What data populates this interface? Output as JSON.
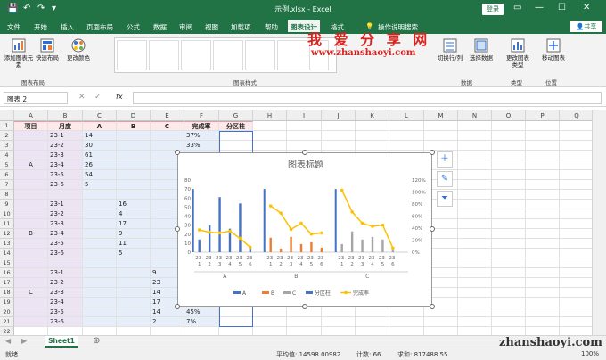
{
  "window": {
    "title": "示例.xlsx  -  Excel",
    "login_label": "登录",
    "quick_access": [
      "💾",
      "↶",
      "↷",
      "▾"
    ],
    "buttons": [
      "—",
      "☐",
      "✕",
      "▭"
    ]
  },
  "tabs": [
    "文件",
    "开始",
    "插入",
    "页面布局",
    "公式",
    "数据",
    "审阅",
    "视图",
    "加载项",
    "帮助",
    "图表设计",
    "格式"
  ],
  "active_tab": "图表设计",
  "tell_me": "操作说明搜索",
  "share_label": "共享",
  "ribbon": {
    "add_element": "添加图表元素",
    "quick_layout": "快速布局",
    "change_color": "更改颜色",
    "group_layout": "图表布局",
    "group_styles": "图表样式",
    "switch_rowcol": "切换行/列",
    "select_data": "选择数据",
    "group_data": "数据",
    "change_type": "更改图表类型",
    "group_type": "类型",
    "move_chart": "移动图表",
    "group_location": "位置"
  },
  "watermark": {
    "cn": "我 爱 分 享 网",
    "url": "www.zhanshaoyi.com",
    "bottom": "zhanshaoyi.com"
  },
  "formula_bar": {
    "name_box": "图表 2",
    "fx": "fx"
  },
  "columns": [
    "A",
    "B",
    "C",
    "D",
    "E",
    "F",
    "G",
    "H",
    "I",
    "J",
    "K",
    "L",
    "M",
    "N",
    "O",
    "P",
    "Q"
  ],
  "headers": [
    "项目",
    "月度",
    "A",
    "B",
    "C",
    "完成率",
    "分区柱"
  ],
  "rows": [
    {
      "r": "1"
    },
    {
      "r": "2",
      "b": "23-1",
      "c": "14",
      "f": "37%"
    },
    {
      "r": "3",
      "b": "23-2",
      "c": "30",
      "f": "33%"
    },
    {
      "r": "4",
      "b": "23-3",
      "c": "61"
    },
    {
      "r": "5",
      "a": "A",
      "b": "23-4",
      "c": "26"
    },
    {
      "r": "6",
      "b": "23-5",
      "c": "54"
    },
    {
      "r": "7",
      "b": "23-6",
      "c": "5"
    },
    {
      "r": "8"
    },
    {
      "r": "9",
      "b": "23-1",
      "d": "16"
    },
    {
      "r": "10",
      "b": "23-2",
      "d": "4"
    },
    {
      "r": "11",
      "b": "23-3",
      "d": "17"
    },
    {
      "r": "12",
      "a": "B",
      "b": "23-4",
      "d": "9"
    },
    {
      "r": "13",
      "b": "23-5",
      "d": "11"
    },
    {
      "r": "14",
      "b": "23-6",
      "d": "5"
    },
    {
      "r": "15"
    },
    {
      "r": "16",
      "b": "23-1",
      "e": "9"
    },
    {
      "r": "17",
      "b": "23-2",
      "e": "23"
    },
    {
      "r": "18",
      "a": "C",
      "b": "23-3",
      "e": "14"
    },
    {
      "r": "19",
      "b": "23-4",
      "e": "17"
    },
    {
      "r": "20",
      "b": "23-5",
      "e": "14",
      "f": "45%"
    },
    {
      "r": "21",
      "b": "23-6",
      "e": "2",
      "f": "7%"
    },
    {
      "r": "22"
    }
  ],
  "sheet_tab": "Sheet1",
  "status": {
    "ready": "就绪",
    "average": "平均值: 14598.00982",
    "count": "计数: 66",
    "sum": "求和: 817488.55",
    "zoom": "100%"
  },
  "colors": {
    "excel_green": "#217346",
    "A": "#4472c4",
    "B": "#ed7d31",
    "C": "#a5a5a5",
    "partition": "#4472c4",
    "rate": "#ffc000"
  },
  "chart_data": {
    "type": "bar",
    "title": "图表标题",
    "groups": [
      "A",
      "B",
      "C"
    ],
    "categories": [
      "23-1",
      "23-2",
      "23-3",
      "23-4",
      "23-5",
      "23-6"
    ],
    "series": [
      {
        "name": "A",
        "values": [
          14,
          30,
          61,
          26,
          54,
          5,
          null,
          null,
          null,
          null,
          null,
          null,
          null,
          null,
          null,
          null,
          null,
          null
        ]
      },
      {
        "name": "B",
        "values": [
          null,
          null,
          null,
          null,
          null,
          null,
          16,
          4,
          17,
          9,
          11,
          5,
          null,
          null,
          null,
          null,
          null,
          null
        ]
      },
      {
        "name": "C",
        "values": [
          null,
          null,
          null,
          null,
          null,
          null,
          null,
          null,
          null,
          null,
          null,
          null,
          9,
          23,
          14,
          17,
          14,
          2
        ]
      },
      {
        "name": "分区柱",
        "values": [
          70,
          70,
          70
        ]
      },
      {
        "name": "完成率",
        "values": [
          0.37,
          0.33,
          0.32,
          0.35,
          0.23,
          0.08,
          0.77,
          0.65,
          0.38,
          0.48,
          0.3,
          0.32,
          1.03,
          0.67,
          0.48,
          0.43,
          0.45,
          0.07
        ]
      }
    ],
    "y_ticks": [
      "0",
      "10",
      "20",
      "30",
      "40",
      "50",
      "60",
      "70",
      "80"
    ],
    "y2_ticks": [
      "0%",
      "20%",
      "40%",
      "60%",
      "80%",
      "100%",
      "120%"
    ],
    "ylim": [
      0,
      80
    ],
    "y2lim": [
      0,
      1.2
    ],
    "legend_position": "bottom"
  }
}
